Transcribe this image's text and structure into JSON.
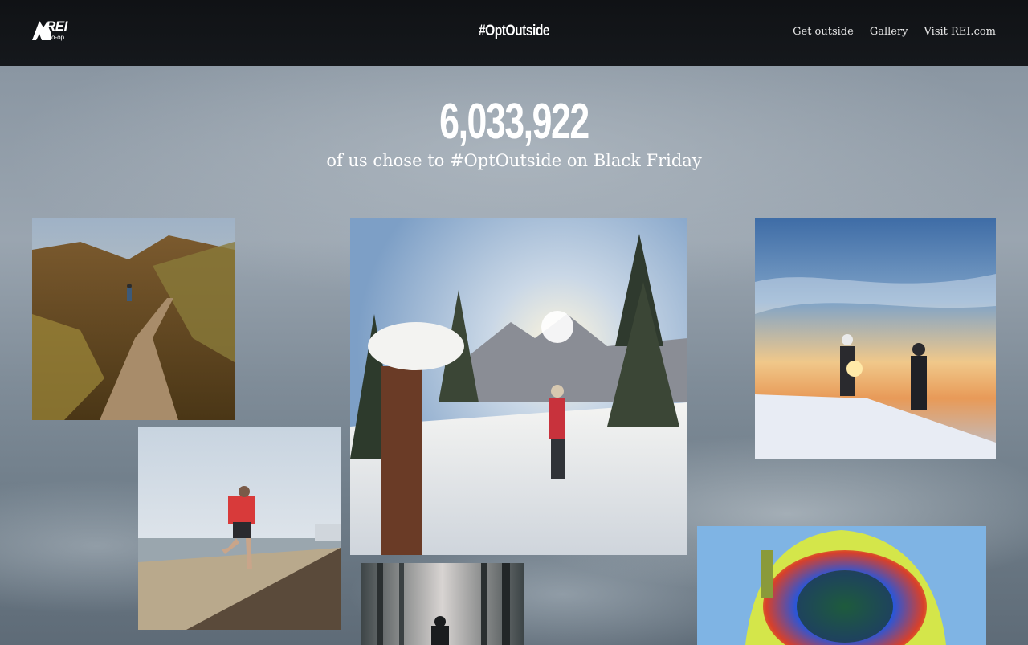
{
  "header": {
    "logo_text": "REI",
    "logo_sub": "co-op",
    "campaign": "#OptOutside",
    "nav": [
      {
        "label": "Get outside"
      },
      {
        "label": "Gallery"
      },
      {
        "label": "Visit REI.com"
      }
    ]
  },
  "hero": {
    "count": "6,033,922",
    "subtitle": "of us chose to #OptOutside on Black Friday"
  },
  "gallery": {
    "photos": [
      {
        "subject": "boardwalk-hiker"
      },
      {
        "subject": "snowshoe-hiker-sunburst"
      },
      {
        "subject": "two-hikers-sunset"
      },
      {
        "subject": "beach-runner"
      },
      {
        "subject": "misty-forest-walker"
      },
      {
        "subject": "ski-goggles-closeup"
      }
    ]
  },
  "colors": {
    "header_bg": "#121417",
    "text": "#ffffff"
  }
}
